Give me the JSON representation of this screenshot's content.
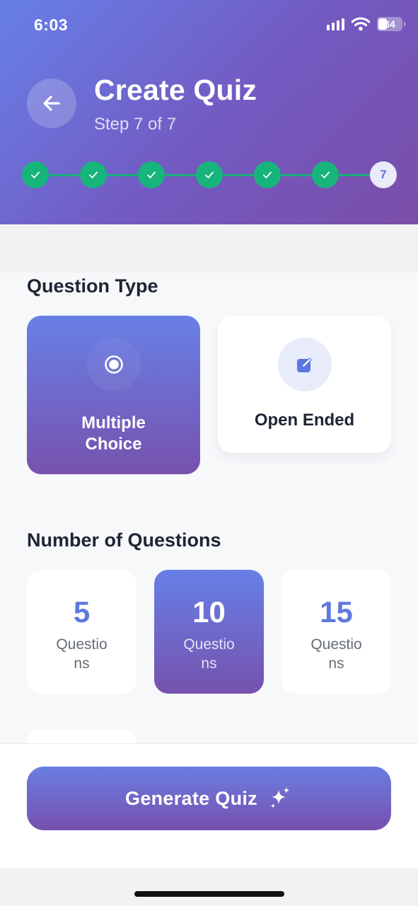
{
  "status_bar": {
    "time": "6:03",
    "battery": "34"
  },
  "header": {
    "title": "Create Quiz",
    "subtitle": "Step 7 of 7"
  },
  "stepper": {
    "completed_steps": 6,
    "current_step": "7",
    "total_steps": 7
  },
  "question_type": {
    "label": "Question Type",
    "options": [
      {
        "label": "Multiple Choice",
        "icon": "radio-button-icon",
        "selected": true
      },
      {
        "label": "Open Ended",
        "icon": "edit-icon",
        "selected": false
      }
    ]
  },
  "number_of_questions": {
    "label": "Number of Questions",
    "options": [
      {
        "value": "5",
        "caption": "Questions",
        "selected": false
      },
      {
        "value": "10",
        "caption": "Questions",
        "selected": true
      },
      {
        "value": "15",
        "caption": "Questions",
        "selected": false
      }
    ]
  },
  "footer": {
    "generate_label": "Generate Quiz",
    "generate_icon": "sparkles-icon"
  },
  "colors": {
    "accent_start": "#6680e8",
    "accent_end": "#7a4ea8",
    "success": "#17b57b"
  }
}
